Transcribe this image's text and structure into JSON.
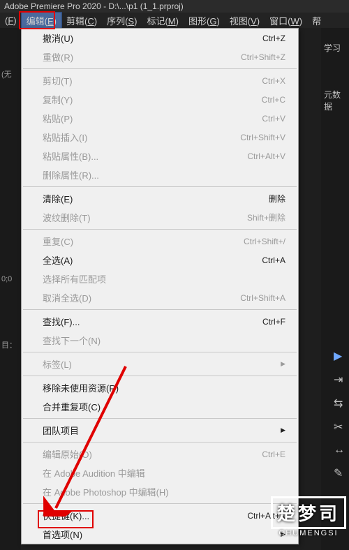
{
  "title_bar": "Adobe Premiere Pro 2020 - D:\\...\\p1 (1_1.prproj)",
  "menubar": [
    {
      "label": "(F)",
      "ul": "F",
      "active": false
    },
    {
      "label": "编辑(E)",
      "ul": "E",
      "active": true
    },
    {
      "label": "剪辑(C)",
      "ul": "C",
      "active": false
    },
    {
      "label": "序列(S)",
      "ul": "S",
      "active": false
    },
    {
      "label": "标记(M)",
      "ul": "M",
      "active": false
    },
    {
      "label": "图形(G)",
      "ul": "G",
      "active": false
    },
    {
      "label": "视图(V)",
      "ul": "V",
      "active": false
    },
    {
      "label": "窗口(W)",
      "ul": "W",
      "active": false
    },
    {
      "label": "帮",
      "ul": "",
      "active": false
    }
  ],
  "bg_left": {
    "timecode": "0;0",
    "label2": "(无",
    "label3": "目："
  },
  "bg_right": {
    "tab1": "学习",
    "tab2": "元数据"
  },
  "menu": [
    {
      "type": "item",
      "label": "撤消(U)",
      "shortcut": "Ctrl+Z",
      "disabled": false
    },
    {
      "type": "item",
      "label": "重做(R)",
      "shortcut": "Ctrl+Shift+Z",
      "disabled": true
    },
    {
      "type": "sep"
    },
    {
      "type": "item",
      "label": "剪切(T)",
      "shortcut": "Ctrl+X",
      "disabled": true
    },
    {
      "type": "item",
      "label": "复制(Y)",
      "shortcut": "Ctrl+C",
      "disabled": true
    },
    {
      "type": "item",
      "label": "粘贴(P)",
      "shortcut": "Ctrl+V",
      "disabled": true
    },
    {
      "type": "item",
      "label": "粘贴插入(I)",
      "shortcut": "Ctrl+Shift+V",
      "disabled": true
    },
    {
      "type": "item",
      "label": "粘贴属性(B)...",
      "shortcut": "Ctrl+Alt+V",
      "disabled": true
    },
    {
      "type": "item",
      "label": "删除属性(R)...",
      "shortcut": "",
      "disabled": true
    },
    {
      "type": "sep"
    },
    {
      "type": "item",
      "label": "清除(E)",
      "shortcut": "删除",
      "disabled": false
    },
    {
      "type": "item",
      "label": "波纹删除(T)",
      "shortcut": "Shift+删除",
      "disabled": true
    },
    {
      "type": "sep"
    },
    {
      "type": "item",
      "label": "重复(C)",
      "shortcut": "Ctrl+Shift+/",
      "disabled": true
    },
    {
      "type": "item",
      "label": "全选(A)",
      "shortcut": "Ctrl+A",
      "disabled": false
    },
    {
      "type": "item",
      "label": "选择所有匹配项",
      "shortcut": "",
      "disabled": true
    },
    {
      "type": "item",
      "label": "取消全选(D)",
      "shortcut": "Ctrl+Shift+A",
      "disabled": true
    },
    {
      "type": "sep"
    },
    {
      "type": "item",
      "label": "查找(F)...",
      "shortcut": "Ctrl+F",
      "disabled": false
    },
    {
      "type": "item",
      "label": "查找下一个(N)",
      "shortcut": "",
      "disabled": true
    },
    {
      "type": "sep"
    },
    {
      "type": "submenu",
      "label": "标签(L)",
      "shortcut": "",
      "disabled": true
    },
    {
      "type": "sep"
    },
    {
      "type": "item",
      "label": "移除未使用资源(R)",
      "shortcut": "",
      "disabled": false
    },
    {
      "type": "item",
      "label": "合并重复项(C)",
      "shortcut": "",
      "disabled": false
    },
    {
      "type": "sep"
    },
    {
      "type": "submenu",
      "label": "团队项目",
      "shortcut": "",
      "disabled": false
    },
    {
      "type": "sep"
    },
    {
      "type": "item",
      "label": "编辑原始(O)",
      "shortcut": "Ctrl+E",
      "disabled": true
    },
    {
      "type": "item",
      "label": "在 Adobe Audition 中编辑",
      "shortcut": "",
      "disabled": true
    },
    {
      "type": "item",
      "label": "在 Adobe Photoshop 中编辑(H)",
      "shortcut": "",
      "disabled": true
    },
    {
      "type": "sep"
    },
    {
      "type": "item",
      "label": "快捷键(K)...",
      "shortcut": "Ctrl+Alt+K",
      "disabled": false
    },
    {
      "type": "submenu",
      "label": "首选项(N)",
      "shortcut": "",
      "disabled": false
    }
  ],
  "watermark": {
    "cn": "楚梦司",
    "en": "CHUMENGSI"
  }
}
